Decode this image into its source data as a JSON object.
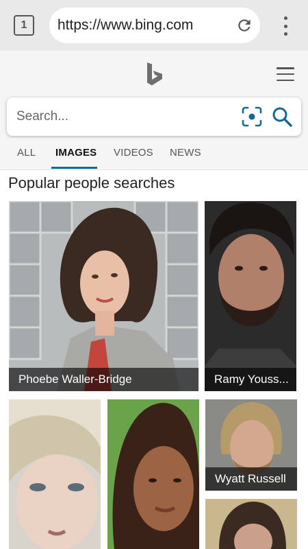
{
  "browser": {
    "tab_count": "1",
    "url": "https://www.bing.com"
  },
  "search": {
    "placeholder": "Search..."
  },
  "tabs": [
    {
      "label": "ALL",
      "active": false
    },
    {
      "label": "IMAGES",
      "active": true
    },
    {
      "label": "VIDEOS",
      "active": false
    },
    {
      "label": "NEWS",
      "active": false
    }
  ],
  "section": {
    "title": "Popular people searches"
  },
  "people": [
    {
      "name": "Phoebe Waller-Bridge"
    },
    {
      "name": "Ramy Youss..."
    },
    {
      "name": "Wyatt Russell"
    }
  ],
  "colors": {
    "accent": "#0c6b94",
    "chrome": "#e9e9e9",
    "header_bg": "#f5f5f5"
  }
}
